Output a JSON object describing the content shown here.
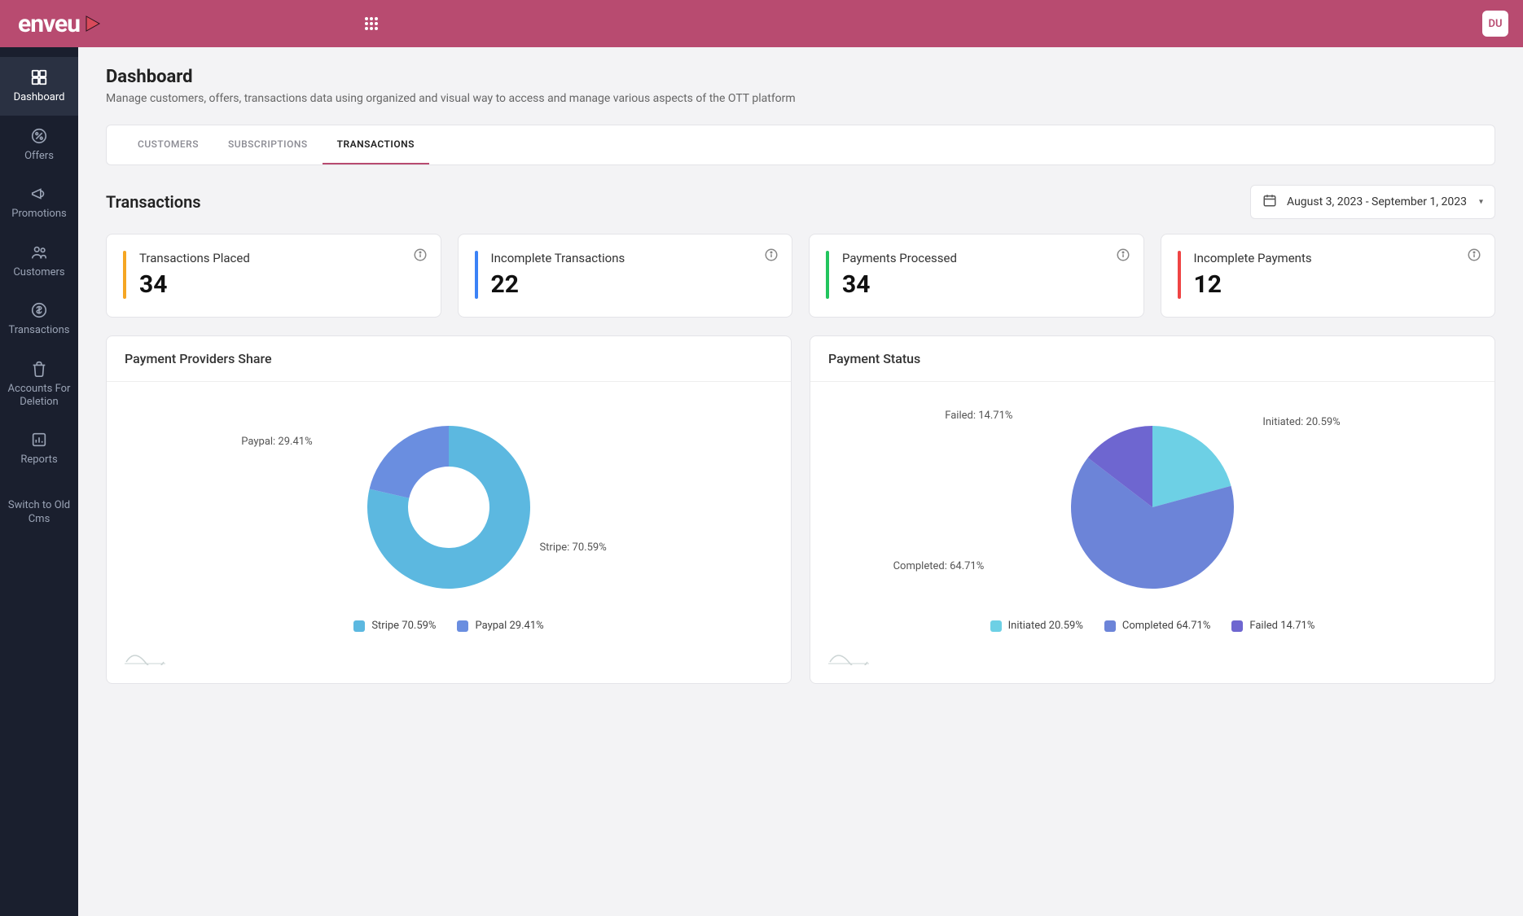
{
  "brand": {
    "name": "enveu"
  },
  "user": {
    "initials": "DU"
  },
  "sidebar": {
    "items": [
      {
        "label": "Dashboard",
        "active": true
      },
      {
        "label": "Offers"
      },
      {
        "label": "Promotions"
      },
      {
        "label": "Customers"
      },
      {
        "label": "Transactions"
      },
      {
        "label": "Accounts For Deletion"
      },
      {
        "label": "Reports"
      }
    ],
    "switch_link": "Switch to Old Cms"
  },
  "page": {
    "title": "Dashboard",
    "subtitle": "Manage customers, offers, transactions data using organized and visual way to access and manage various aspects of the OTT platform"
  },
  "tabs": [
    {
      "label": "CUSTOMERS"
    },
    {
      "label": "SUBSCRIPTIONS"
    },
    {
      "label": "TRANSACTIONS",
      "active": true
    }
  ],
  "section_title": "Transactions",
  "date_range": "August 3, 2023 - September 1, 2023",
  "stats": [
    {
      "label": "Transactions Placed",
      "value": "34",
      "stripe": "orange"
    },
    {
      "label": "Incomplete Transactions",
      "value": "22",
      "stripe": "blue"
    },
    {
      "label": "Payments Processed",
      "value": "34",
      "stripe": "green"
    },
    {
      "label": "Incomplete Payments",
      "value": "12",
      "stripe": "red"
    }
  ],
  "charts": [
    {
      "title": "Payment Providers Share",
      "labels": {
        "a": "Stripe: 70.59%",
        "b": "Paypal: 29.41%"
      },
      "legend": [
        {
          "text": "Stripe  70.59%",
          "swatch": "sw-lblue"
        },
        {
          "text": "Paypal  29.41%",
          "swatch": "sw-mblue"
        }
      ]
    },
    {
      "title": "Payment Status",
      "labels": {
        "a": "Initiated: 20.59%",
        "b": "Completed: 64.71%",
        "c": "Failed: 14.71%"
      },
      "legend": [
        {
          "text": "Initiated  20.59%",
          "swatch": "sw-cyan"
        },
        {
          "text": "Completed  64.71%",
          "swatch": "sw-slate"
        },
        {
          "text": "Failed  14.71%",
          "swatch": "sw-purple"
        }
      ]
    }
  ],
  "chart_data": [
    {
      "type": "pie",
      "title": "Payment Providers Share",
      "series": [
        {
          "name": "Stripe",
          "value": 70.59
        },
        {
          "name": "Paypal",
          "value": 29.41
        }
      ]
    },
    {
      "type": "pie",
      "title": "Payment Status",
      "series": [
        {
          "name": "Initiated",
          "value": 20.59
        },
        {
          "name": "Completed",
          "value": 64.71
        },
        {
          "name": "Failed",
          "value": 14.71
        }
      ]
    }
  ]
}
